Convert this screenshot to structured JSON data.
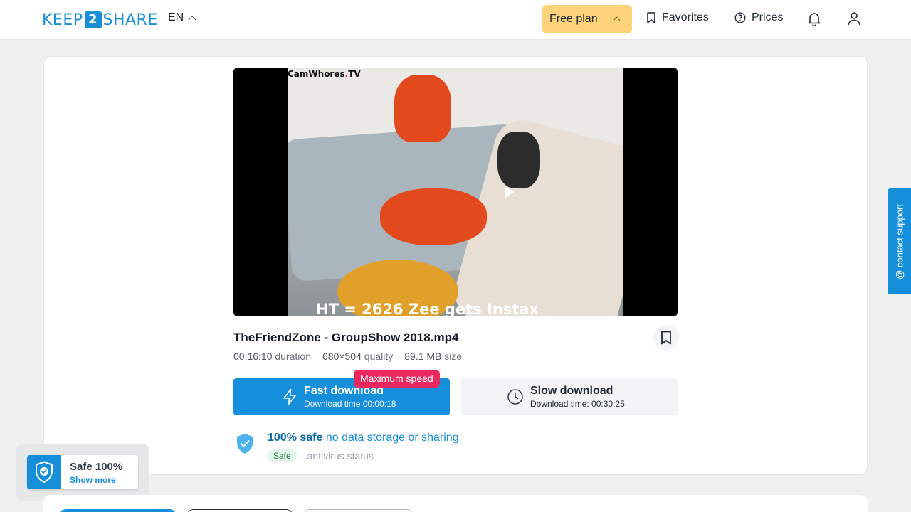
{
  "header": {
    "logo_left": "KEEP",
    "logo_mid": "2",
    "logo_right": "SHARE",
    "language": "EN",
    "plan_label": "Free plan",
    "favorites_label": "Favorites",
    "prices_label": "Prices"
  },
  "video": {
    "watermark_left": "CamWhores",
    "watermark_dot": ".",
    "watermark_right": "TV",
    "caption": "HT = 2626 Zee gets Instax"
  },
  "file": {
    "name": "TheFriendZone - GroupShow 2018.mp4",
    "duration_value": "00:16:10",
    "duration_label": "duration",
    "quality_value": "680×504",
    "quality_label": "quality",
    "size_value": "89.1 MB",
    "size_label": "size"
  },
  "download": {
    "badge": "Maximum speed",
    "fast_title": "Fast download",
    "fast_sub": "Download time 00:00:18",
    "slow_title": "Slow download",
    "slow_sub": "Download time: 00:30:25"
  },
  "safety": {
    "strong": "100% safe",
    "text": " no data storage or sharing",
    "tag": "Safe",
    "antivirus": "- antivirus status"
  },
  "contact_label": "@ contact support",
  "safe_widget": {
    "title": "Safe 100%",
    "link": "Show more"
  },
  "colors": {
    "primary": "#168fda",
    "plan": "#fcd27a",
    "badge": "#e8285f"
  }
}
